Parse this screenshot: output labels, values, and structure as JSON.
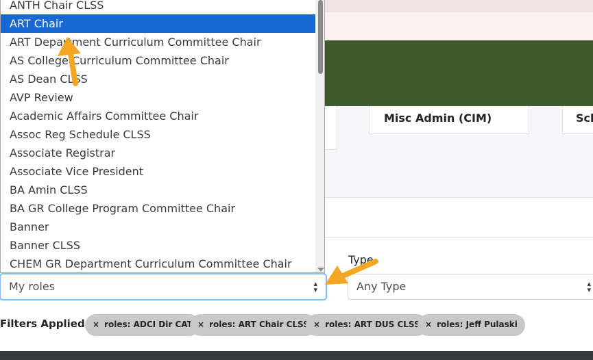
{
  "cards": [
    {
      "title": ""
    },
    {
      "title": "Misc Admin (CIM)"
    },
    {
      "title": "Sch"
    }
  ],
  "filters": {
    "type_label": "Type",
    "roles_select_value": "My roles",
    "type_select_value": "Any Type",
    "applied_label": "Filters Applied:",
    "chips": [
      {
        "label": "roles: ADCI Dir CAT"
      },
      {
        "label": "roles: ART Chair CLSS"
      },
      {
        "label": "roles: ART DUS CLSS"
      },
      {
        "label": "roles: Jeff Pulaski"
      }
    ],
    "chip_remove_glyph": "×"
  },
  "dropdown": {
    "selected_index": 1,
    "options": [
      "ANTH Chair CLSS",
      "ART Chair",
      "ART Department Curriculum Committee Chair",
      "AS College Curriculum Committee Chair",
      "AS Dean CLSS",
      "AVP Review",
      "Academic Affairs Committee Chair",
      "Assoc Reg Schedule CLSS",
      "Associate Registrar",
      "Associate Vice President",
      "BA Amin CLSS",
      "BA GR College Program Committee Chair",
      "Banner",
      "Banner CLSS",
      "CHEM GR Department Curriculum Committee Chair"
    ]
  },
  "colors": {
    "header_green": "#405a2e",
    "selected_blue": "#1967d2",
    "annotation_arrow": "#f5a623",
    "chip_gray": "#c9c9c9"
  },
  "icons": {
    "select_arrows": "sort-arrows-icon",
    "annotation": "annotation-arrow-icon",
    "scroll_down": "scroll-down-icon"
  }
}
